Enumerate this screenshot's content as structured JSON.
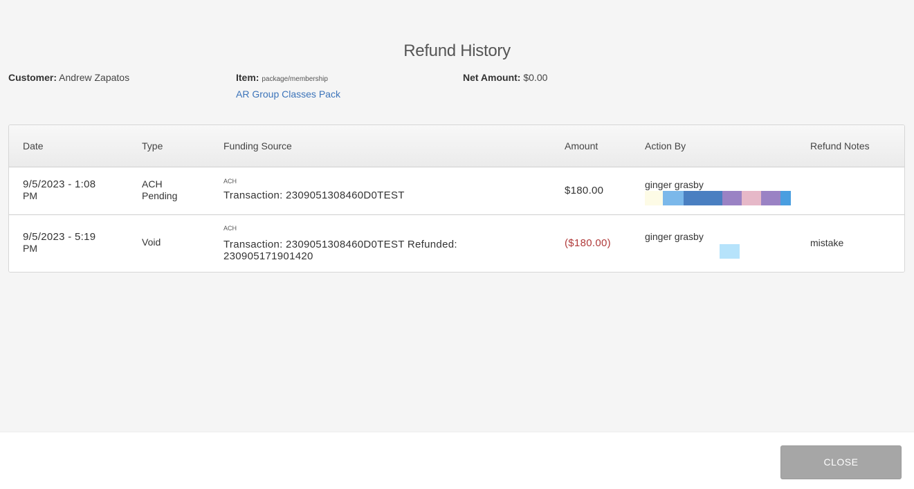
{
  "title": "Refund History",
  "summary": {
    "customer_label": "Customer:",
    "customer_value": "Andrew Zapatos",
    "item_label": "Item:",
    "item_type": "package/membership",
    "item_link": "AR Group Classes Pack",
    "net_label": "Net Amount:",
    "net_value": "$0.00"
  },
  "table": {
    "headers": [
      "Date",
      "Type",
      "Funding Source",
      "Amount",
      "Action By",
      "Refund Notes"
    ],
    "rows": [
      {
        "date_line1": "9/5/2023 - 1:08",
        "date_line2": "PM",
        "type_line1": "ACH",
        "type_line2": "Pending",
        "funding_method": "ACH",
        "funding_line1": "Transaction: 2309051308460D0TEST",
        "funding_line2": "",
        "amount": "$180.00",
        "action_by": "ginger grasby",
        "notes": ""
      },
      {
        "date_line1": "9/5/2023 - 5:19",
        "date_line2": "PM",
        "type_line1": "Void",
        "type_line2": "",
        "funding_method": "ACH",
        "funding_line1": "Transaction: 2309051308460D0TEST Refunded:",
        "funding_line2": "230905171901420",
        "amount": "($180.00)",
        "action_by": "ginger grasby",
        "notes": "mistake"
      }
    ]
  },
  "colors": {
    "link": "#3b73b9",
    "negative_amount": "#b03a3a",
    "close_button": "#a6a6a6",
    "row1_swatches": [
      "#fdfbe6",
      "#7bb8ea",
      "#4a7fc1",
      "#9a82c4",
      "#e6b8c8",
      "#9a82c4",
      "#4a9ee0"
    ],
    "row2_swatches": [
      "#b6e3fb"
    ]
  },
  "footer": {
    "close_label": "CLOSE"
  }
}
